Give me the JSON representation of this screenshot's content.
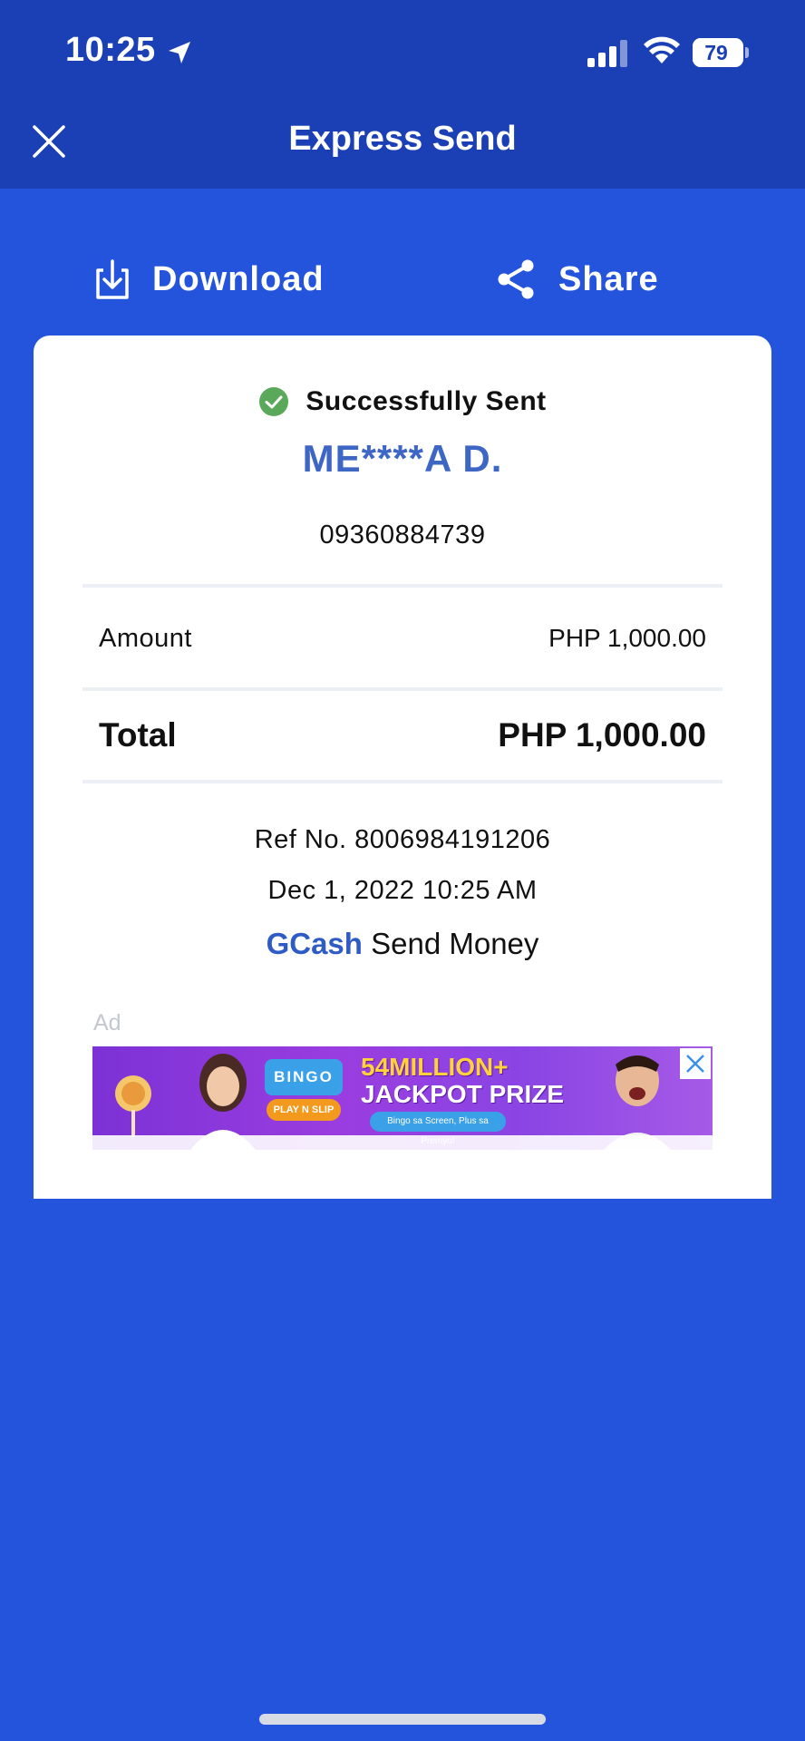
{
  "status_bar": {
    "time": "10:25",
    "battery": "79",
    "battery_level": 0.79
  },
  "nav": {
    "title": "Express Send",
    "close_icon": "close-icon"
  },
  "actions": {
    "download_label": "Download",
    "share_label": "Share"
  },
  "receipt": {
    "status": "Successfully Sent",
    "recipient_name": "ME****A D.",
    "recipient_number": "09360884739",
    "amount_label": "Amount",
    "amount_value": "PHP 1,000.00",
    "total_label": "Total",
    "total_value": "PHP 1,000.00",
    "ref_no": "Ref No. 8006984191206",
    "datetime": "Dec 1, 2022 10:25 AM",
    "brand": "GCash",
    "brand_suffix": "Send Money"
  },
  "ad": {
    "label": "Ad",
    "bingo": "BINGO",
    "play": "PLAY N SLIP",
    "headline_1": "54MILLION+",
    "headline_2": "JACKPOT PRIZE",
    "pill": "Bingo sa Screen, Plus sa Premyo!"
  },
  "colors": {
    "background": "#2454dc",
    "topbar": "#1b40b6",
    "accent": "#3e66c4",
    "success": "#5aa85a"
  }
}
